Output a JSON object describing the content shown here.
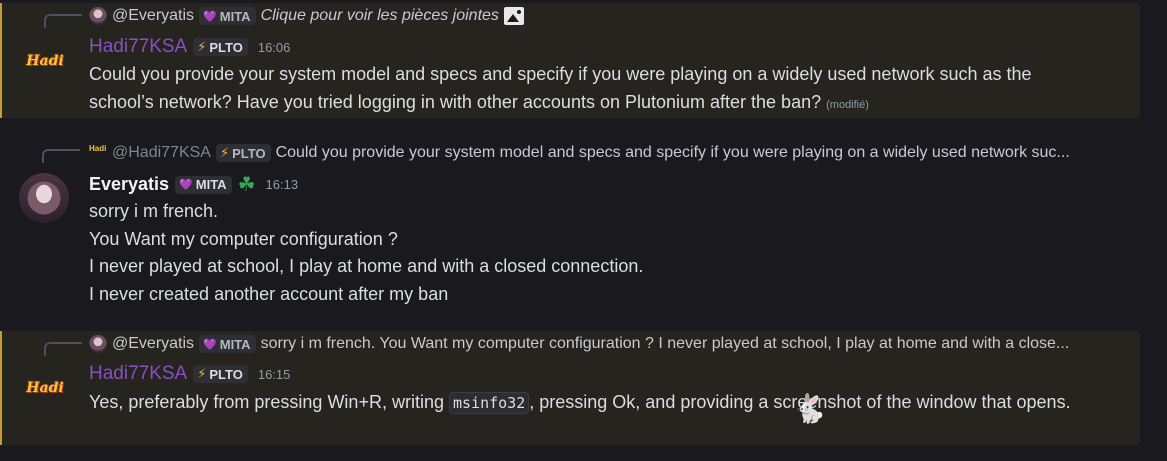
{
  "messages": [
    {
      "reply": {
        "author": "@Everyatis",
        "tag": "MITA",
        "text": "Clique pour voir les pièces jointes"
      },
      "author": "Hadi77KSA",
      "avatar_text": "Hadi",
      "tag": "PLTO",
      "time": "16:06",
      "text": "Could you provide your system model and specs and specify if you were playing on a widely used network such as the school’s network? Have you tried logging in with other accounts on Plutonium after the ban?",
      "edited": "(modifié)"
    },
    {
      "reply": {
        "author": "@Hadi77KSA",
        "tag": "PLTO",
        "text": "Could you provide your system model and specs and specify if you were playing on a widely used network suc..."
      },
      "author": "Everyatis",
      "tag": "MITA",
      "time": "16:13",
      "lines": [
        "sorry i m french.",
        "You Want my computer configuration ?",
        "I never played at school, I play at home and with a closed connection.",
        "I never created another account after my ban"
      ]
    },
    {
      "reply": {
        "author": "@Everyatis",
        "tag": "MITA",
        "text": "sorry i m french. You Want my computer configuration ? I never played at school, I play at home and with a close..."
      },
      "author": "Hadi77KSA",
      "avatar_text": "Hadi",
      "tag": "PLTO",
      "time": "16:15",
      "text_before": "Yes, preferably from pressing Win+R, writing",
      "code": "msinfo32",
      "text_after": ", pressing Ok, and providing a screenshot of the window that opens."
    }
  ],
  "colors": {
    "highlight_bg": "#26241e",
    "highlight_border": "#c79a35",
    "hadi_name": "#8a4fc2",
    "bolt": "#f0b232",
    "heart": "#b69ae8",
    "clover": "#3ba55d"
  },
  "icons": {
    "attachment": "image-icon",
    "heart": "heart-icon",
    "bolt": "lightning-icon",
    "clover": "clover-icon",
    "cursor": "rabbit-cursor-icon"
  }
}
